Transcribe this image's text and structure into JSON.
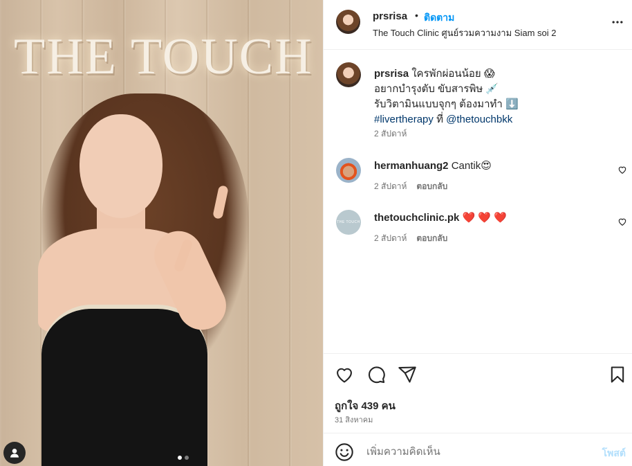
{
  "media": {
    "sign_text": "THE TOUCH",
    "carousel_dots": 2,
    "active_dot": 0,
    "tag_icon": "user-tag-icon"
  },
  "header": {
    "username": "prsrisa",
    "separator": "•",
    "follow_label": "ติดตาม",
    "location": "The Touch Clinic ศูนย์รวมความงาม Siam soi 2",
    "more_icon": "more-options-icon"
  },
  "caption": {
    "username": "prsrisa",
    "line1": "ใครพักผ่อนน้อย 😱",
    "line2": "อยากบำรุงตับ ขับสารพิษ 💉",
    "line3": "รับวิตามินแบบจุกๆ ต้องมาทำ ⬇️",
    "hashtag": "#livertherapy",
    "at_word": "ที่",
    "mention": "@thetouchbkk",
    "time": "2 สัปดาห์"
  },
  "comments": [
    {
      "username": "hermanhuang2",
      "text": "Cantik😍",
      "time": "2 สัปดาห์",
      "reply_label": "ตอบกลับ"
    },
    {
      "username": "thetouchclinic.pk",
      "text": "❤️ ❤️ ❤️",
      "time": "2 สัปดาห์",
      "reply_label": "ตอบกลับ",
      "avatar_text": "THE TOUCH"
    }
  ],
  "actions": {
    "likes": "ถูกใจ 439 คน",
    "date": "31 สิงหาคม"
  },
  "add_comment": {
    "placeholder": "เพิ่มความคิดเห็น",
    "post_label": "โพสต์"
  },
  "colors": {
    "accent": "#0095f6",
    "text": "#262626",
    "muted": "#737373",
    "border": "#efefef",
    "post_disabled": "#b2dffc",
    "mention": "#00376b"
  }
}
